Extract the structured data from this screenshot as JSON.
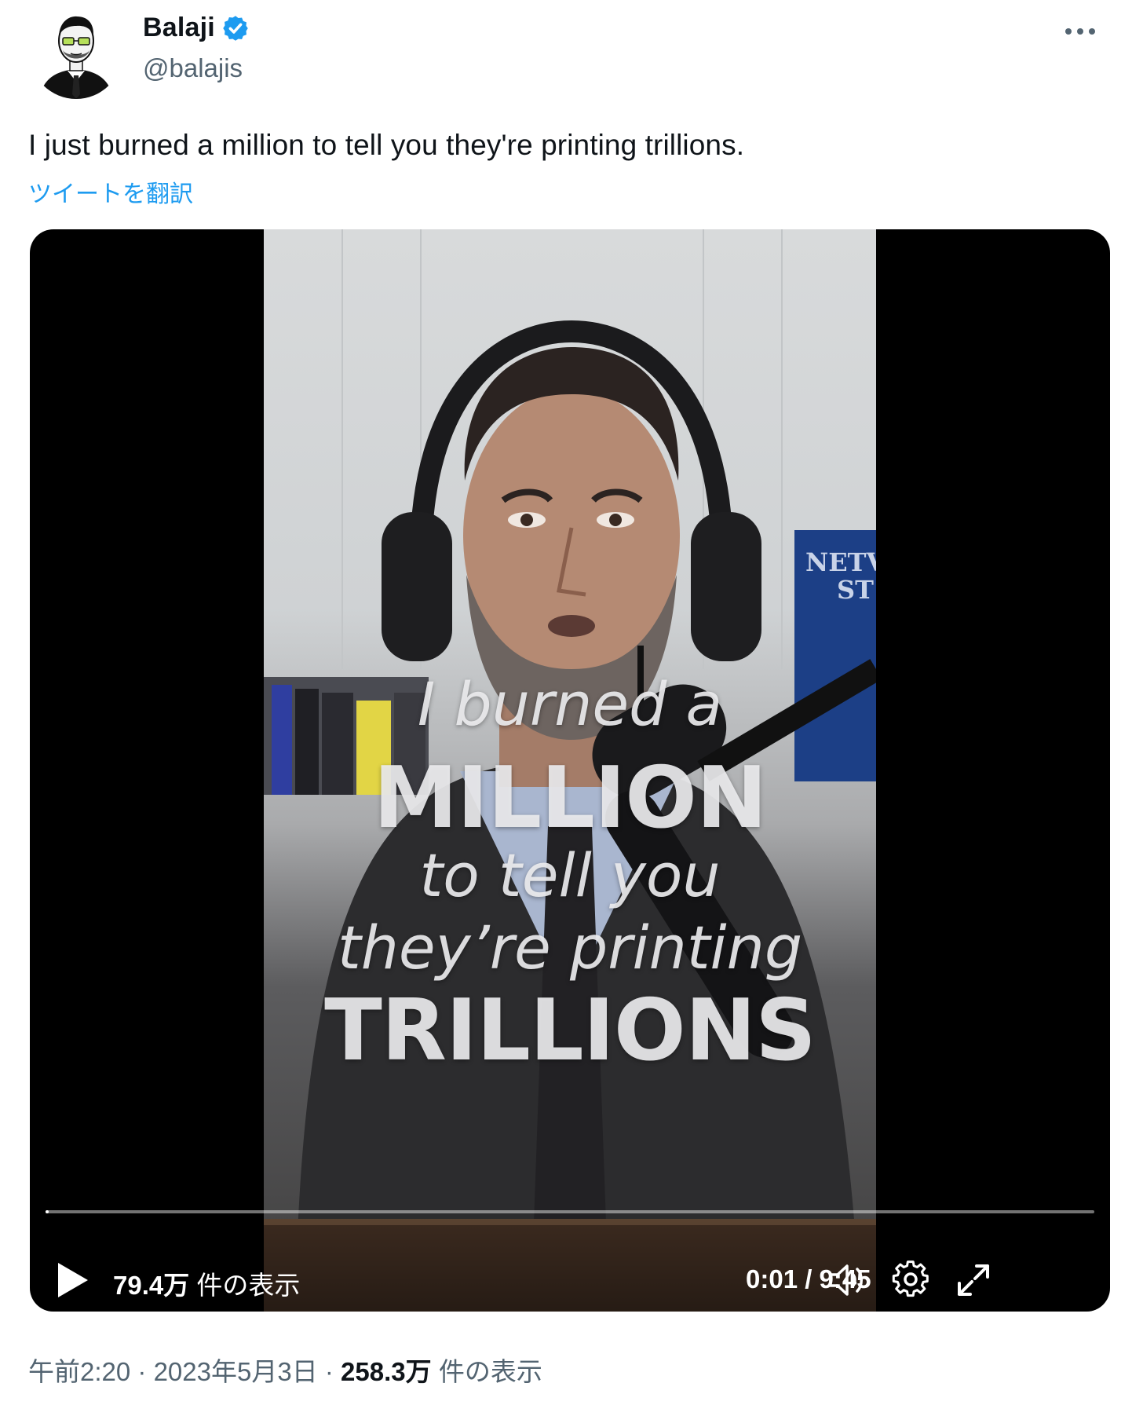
{
  "author": {
    "display_name": "Balaji",
    "handle": "@balajis",
    "verified": true,
    "avatar_icon": "sketch-portrait-avatar"
  },
  "more_icon": "more-dots-icon",
  "tweet": {
    "text": "I just burned a million to tell you they're printing trillions.",
    "translate_label": "ツイートを翻訳"
  },
  "video": {
    "overlay_lines": [
      "I burned a",
      "MILLION",
      "to tell you",
      "they’re printing",
      "TRILLIONS"
    ],
    "poster_sign": [
      "NETV",
      "ST"
    ],
    "progress_fraction": 0.002,
    "views_count": "79.4万",
    "views_label": "件の表示",
    "time_display": "0:01 / 9:45",
    "play_icon": "play-icon",
    "volume_icon": "volume-icon",
    "settings_icon": "settings-gear-icon",
    "fullscreen_icon": "fullscreen-expand-icon"
  },
  "footer": {
    "time": "午前2:20",
    "date": "2023年5月3日",
    "separator": "·",
    "views_count": "258.3万",
    "views_label": "件の表示"
  },
  "colors": {
    "link": "#1d9bf0",
    "secondary_text": "#536471",
    "primary_text": "#0f1419",
    "verified_badge": "#1d9bf0"
  }
}
